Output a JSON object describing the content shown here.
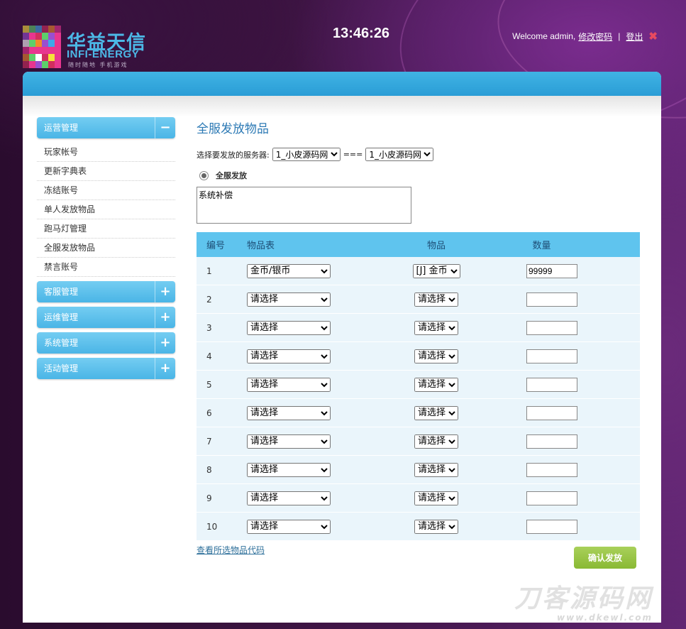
{
  "header": {
    "logo_cn": "华益天信",
    "logo_en": "INFI-ENERGY",
    "logo_sub": "随时随地 手机游戏",
    "clock": "13:46:26",
    "welcome": "Welcome admin,",
    "change_password": "修改密码",
    "separator": "|",
    "logout": "登出",
    "logout_icon": "close-icon"
  },
  "sidebar": {
    "groups": [
      {
        "label": "运营管理",
        "toggle": "−",
        "expanded": true,
        "items": [
          "玩家帐号",
          "更新字典表",
          "冻结账号",
          "单人发放物品",
          "跑马灯管理",
          "全服发放物品",
          "禁言账号"
        ]
      },
      {
        "label": "客服管理",
        "toggle": "+"
      },
      {
        "label": "运维管理",
        "toggle": "+"
      },
      {
        "label": "系统管理",
        "toggle": "+"
      },
      {
        "label": "活动管理",
        "toggle": "+"
      }
    ]
  },
  "main": {
    "title": "全服发放物品",
    "server_label": "选择要发放的服务器:",
    "server_from": "1_小皮源码网",
    "server_sep": "===",
    "server_to": "1_小皮源码网",
    "radio_label": "全服发放",
    "message": "系统补偿",
    "table": {
      "headers": {
        "no": "编号",
        "table": "物品表",
        "item": "物品",
        "qty": "数量"
      },
      "rows": [
        {
          "no": "1",
          "table": "金币/银币",
          "item": "[J] 金币",
          "qty": "99999"
        },
        {
          "no": "2",
          "table": "请选择",
          "item": "请选择",
          "qty": ""
        },
        {
          "no": "3",
          "table": "请选择",
          "item": "请选择",
          "qty": ""
        },
        {
          "no": "4",
          "table": "请选择",
          "item": "请选择",
          "qty": ""
        },
        {
          "no": "5",
          "table": "请选择",
          "item": "请选择",
          "qty": ""
        },
        {
          "no": "6",
          "table": "请选择",
          "item": "请选择",
          "qty": ""
        },
        {
          "no": "7",
          "table": "请选择",
          "item": "请选择",
          "qty": ""
        },
        {
          "no": "8",
          "table": "请选择",
          "item": "请选择",
          "qty": ""
        },
        {
          "no": "9",
          "table": "请选择",
          "item": "请选择",
          "qty": ""
        },
        {
          "no": "10",
          "table": "请选择",
          "item": "请选择",
          "qty": ""
        }
      ]
    },
    "view_codes_link": "查看所选物品代码",
    "confirm_button": "确认发放"
  },
  "watermark": {
    "cn": "刀客源码网",
    "en": "www.dkewl.com"
  },
  "colors": {
    "accent": "#4ab5e6",
    "title": "#2d7ab5",
    "confirm": "#89b934",
    "logout_x": "#e84a5f"
  }
}
